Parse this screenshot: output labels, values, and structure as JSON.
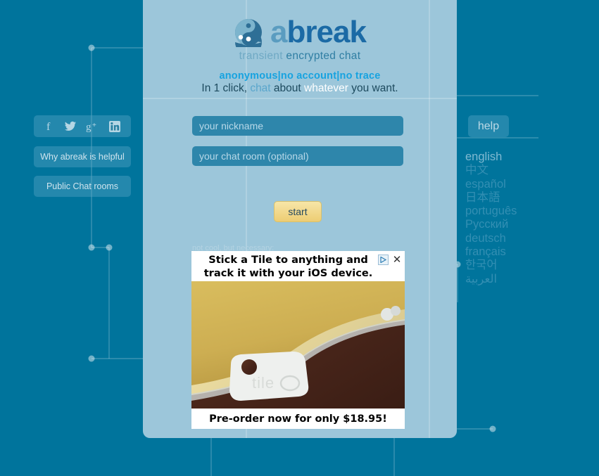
{
  "brand": {
    "logo_icon": "yinyang-icon",
    "name_part1": "a",
    "name_part2": "break",
    "sub_part1": "transient",
    "sub_part2": " encrypted chat"
  },
  "taglines": {
    "line1_a": "anonymous",
    "sep1": "|",
    "line1_b": "no account",
    "sep2": "|",
    "line1_c": "no trace",
    "line2_a": "In 1 click, ",
    "line2_chat": "chat",
    "line2_b": " about ",
    "line2_whatever": "whatever",
    "line2_c": " you want."
  },
  "form": {
    "nickname_placeholder": "your nickname",
    "nickname_value": "",
    "chatroom_placeholder": "your chat room (optional)",
    "chatroom_value": "",
    "start_label": "start",
    "disclaimer": "not cool, but necessary:"
  },
  "sidebar_left": {
    "social": [
      {
        "name": "facebook-icon",
        "glyph": "f"
      },
      {
        "name": "twitter-icon",
        "glyph": "t"
      },
      {
        "name": "googleplus-icon",
        "glyph": "g+"
      },
      {
        "name": "linkedin-icon",
        "glyph": "in"
      }
    ],
    "buttons": [
      {
        "label": "Why abreak is helpful"
      },
      {
        "label": "Public Chat rooms"
      }
    ]
  },
  "sidebar_right": {
    "help_label": "help",
    "languages": [
      {
        "label": "english",
        "active": true
      },
      {
        "label": "中文",
        "active": false
      },
      {
        "label": "español",
        "active": false
      },
      {
        "label": "日本語",
        "active": false
      },
      {
        "label": "português",
        "active": false
      },
      {
        "label": "Русский",
        "active": false
      },
      {
        "label": "deutsch",
        "active": false
      },
      {
        "label": "français",
        "active": false
      },
      {
        "label": "한국어",
        "active": false
      },
      {
        "label": "العربية",
        "active": false
      }
    ]
  },
  "ad": {
    "headline_line1": "Stick a Tile to anything and",
    "headline_line2": "track it with your iOS device.",
    "footer": "Pre-order now for only $18.95!",
    "close_glyph": "✕",
    "adchoices_icon": "adchoices-triangle-icon",
    "product_label": "tile"
  },
  "colors": {
    "page_bg": "#00749c",
    "panel_bg": "#9cc6da",
    "input_bg": "#2e86ab",
    "accent": "#17a3e0",
    "start_button": "#f2d98d",
    "logo_dark": "#1b6aa5"
  }
}
